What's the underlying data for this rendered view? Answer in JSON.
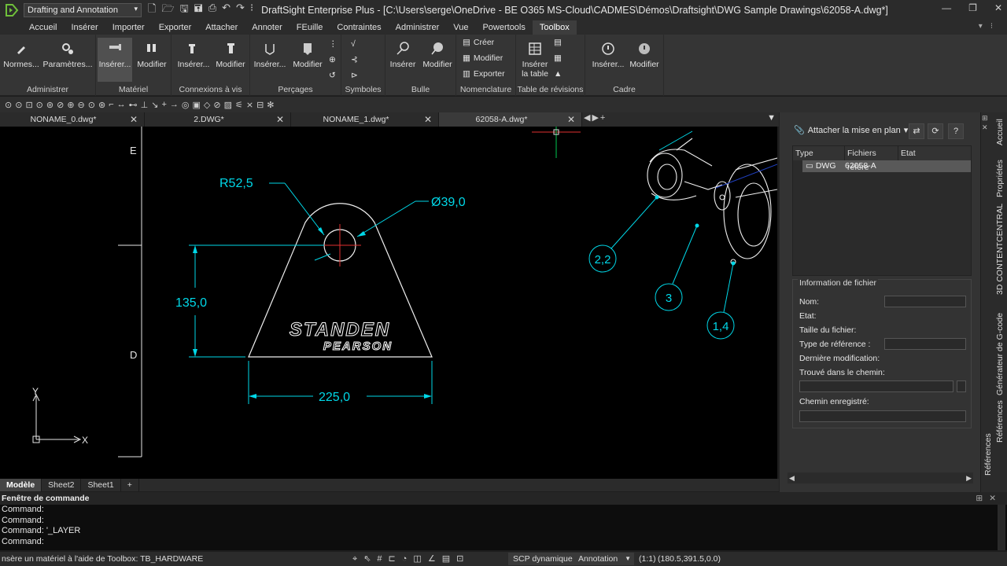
{
  "window": {
    "workspace": "Drafting and Annotation",
    "title": "DraftSight Enterprise Plus - [C:\\Users\\serge\\OneDrive - BE O365 MS-Cloud\\CADMES\\Démos\\Draftsight\\DWG Sample Drawings\\62058-A.dwg*]"
  },
  "ribbon_tabs": [
    "Accueil",
    "Insérer",
    "Importer",
    "Exporter",
    "Attacher",
    "Annoter",
    "FEuille",
    "Contraintes",
    "Administrer",
    "Vue",
    "Powertools",
    "Toolbox"
  ],
  "ribbon_active_tab": "Toolbox",
  "ribbon": {
    "administrer": {
      "label": "Administrer",
      "normes": "Normes...",
      "parametres": "Paramètres..."
    },
    "materiel": {
      "label": "Matériel",
      "inserer": "Insérer...",
      "modifier": "Modifier"
    },
    "connexions": {
      "label": "Connexions à vis",
      "inserer": "Insérer...",
      "modifier": "Modifier"
    },
    "percages": {
      "label": "Perçages",
      "inserer": "Insérer...",
      "modifier": "Modifier"
    },
    "symboles": {
      "label": "Symboles"
    },
    "bulle": {
      "label": "Bulle",
      "inserer": "Insérer",
      "modifier": "Modifier"
    },
    "nomenclature": {
      "label": "Nomenclature",
      "creer": "Créer",
      "modifier": "Modifier",
      "exporter": "Exporter"
    },
    "revisions": {
      "label": "Table de révisions",
      "inserer1": "Insérer",
      "inserer2": "la table"
    },
    "cadre": {
      "label": "Cadre",
      "inserer": "Insérer...",
      "modifier": "Modifier"
    }
  },
  "doc_tabs": [
    "NONAME_0.dwg*",
    "2.DWG*",
    "NONAME_1.dwg*",
    "62058-A.dwg*"
  ],
  "drawing": {
    "radius": "R52,5",
    "diameter": "Ø39,0",
    "height": "135,0",
    "width": "225,0",
    "brand_line1": "STANDEN",
    "brand_line2": "PEARSON",
    "balloon1": "2,2",
    "balloon2": "3",
    "balloon3": "1,4",
    "zone_e": "E",
    "zone_d": "D",
    "axis_y": "Y",
    "axis_x": "X"
  },
  "sheet_tabs": [
    "Modèle",
    "Sheet2",
    "Sheet1",
    "+"
  ],
  "command": {
    "header": "Fenêtre de commande",
    "lines": [
      "Command:",
      "Command:",
      "Command: '_LAYER",
      "Command:"
    ]
  },
  "status": {
    "prompt": "nsère un matériel à l'aide de Toolbox: TB_HARDWARE",
    "scp": "SCP dynamique",
    "annotation": "Annotation",
    "scale": "(1:1)",
    "coords": "(180.5,391.5,0.0)"
  },
  "refs_panel": {
    "attach": "Attacher la mise en plan",
    "col_type": "Type",
    "col_files": "Fichiers référe",
    "col_state": "Etat",
    "row_type": "DWG",
    "row_file": "62058-A",
    "info_title": "Information de fichier",
    "nom": "Nom:",
    "etat": "Etat:",
    "taille": "Taille du fichier:",
    "type_ref": "Type de référence :",
    "derniere": "Dernière modification:",
    "trouve": "Trouvé dans le chemin:",
    "chemin": "Chemin enregistré:"
  },
  "side_tabs": [
    "Accueil",
    "Propriétés",
    "3D CONTENTCENTRAL",
    "Générateur de G-code",
    "Références"
  ],
  "panel_vertical_label": "Références",
  "colors": {
    "accent": "#00d8e8",
    "bg": "#000000",
    "ui": "#333333"
  }
}
